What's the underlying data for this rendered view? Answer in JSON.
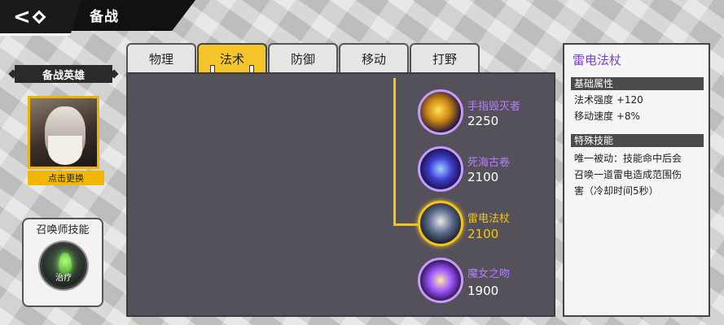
{
  "page": {
    "title": "备战"
  },
  "hero": {
    "section_label": "备战英雄",
    "change_button": "点击更换"
  },
  "summoner": {
    "title": "召唤师技能",
    "skill_label": "治疗"
  },
  "tabs": [
    {
      "label": "物理",
      "active": false
    },
    {
      "label": "法术",
      "active": true
    },
    {
      "label": "防御",
      "active": false
    },
    {
      "label": "移动",
      "active": false
    },
    {
      "label": "打野",
      "active": false
    }
  ],
  "items": [
    {
      "name": "手指毁灭者",
      "price": "2250",
      "icon": "finger-destroyer-icon",
      "selected": false
    },
    {
      "name": "死海古卷",
      "price": "2100",
      "icon": "dead-sea-scroll-icon",
      "selected": false
    },
    {
      "name": "雷电法杖",
      "price": "2100",
      "icon": "thunder-staff-icon",
      "selected": true
    },
    {
      "name": "魔女之吻",
      "price": "1900",
      "icon": "witch-kiss-icon",
      "selected": false
    }
  ],
  "detail": {
    "title": "雷电法杖",
    "basic_header": "基础属性",
    "stat1": "法术强度 +120",
    "stat2": "移动速度 +8%",
    "special_header": "特殊技能",
    "desc_line1": "唯一被动：技能命中后会",
    "desc_line2": "召唤一道雷电造成范围伤",
    "desc_line3": "害（冷却时间5秒）"
  },
  "colors": {
    "accent": "#f4c52a",
    "item_name": "#b57dff",
    "selected": "#f6c419",
    "panel_bg": "#54515a"
  }
}
